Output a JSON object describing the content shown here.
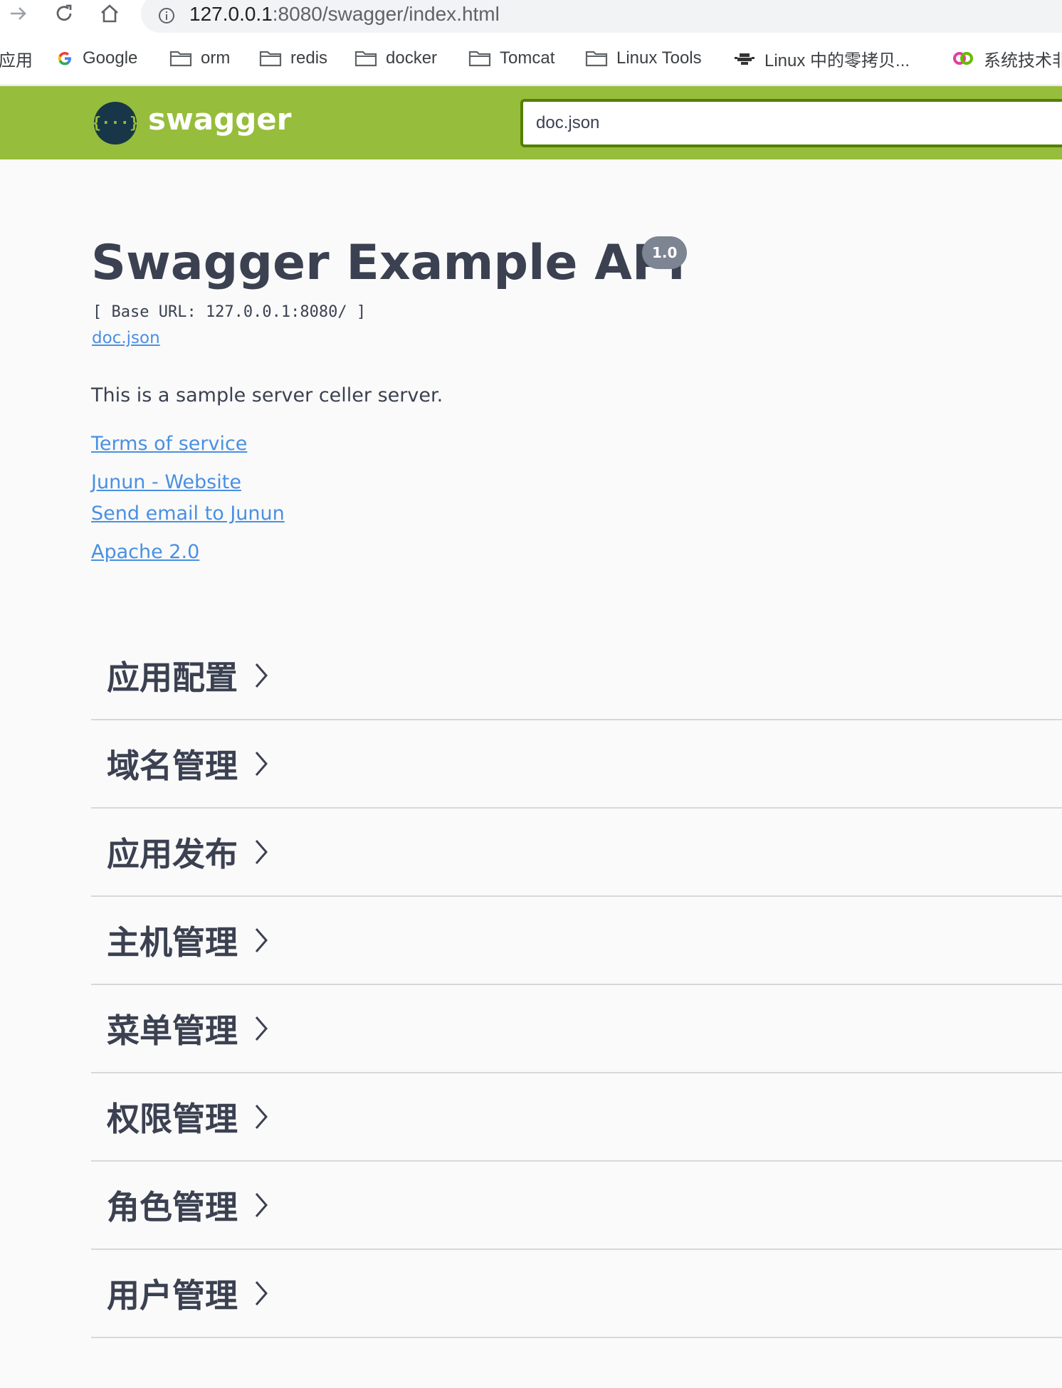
{
  "browser": {
    "url_host": "127.0.0.1",
    "url_rest": ":8080/swagger/index.html",
    "bookmarks": [
      {
        "label": "应用",
        "icon": "apps-icon"
      },
      {
        "label": "Google",
        "icon": "google-icon"
      },
      {
        "label": "orm",
        "icon": "folder-icon"
      },
      {
        "label": "redis",
        "icon": "folder-icon"
      },
      {
        "label": "docker",
        "icon": "folder-icon"
      },
      {
        "label": "Tomcat",
        "icon": "folder-icon"
      },
      {
        "label": "Linux Tools",
        "icon": "folder-icon"
      },
      {
        "label": "Linux 中的零拷贝...",
        "icon": "site-icon"
      },
      {
        "label": "系统技术非",
        "icon": "site-icon"
      }
    ]
  },
  "topbar": {
    "logo_text": "swagger",
    "logo_glyph": "{···}",
    "spec_url": "doc.json",
    "bar_color": "#96bd3b"
  },
  "info": {
    "title": "Swagger Example API",
    "version": "1.0",
    "base_url": "[ Base URL: 127.0.0.1:8080/ ]",
    "spec_link": "doc.json",
    "description": "This is a sample server celler server.",
    "terms_link": "Terms of service",
    "contact_website": "Junun - Website",
    "contact_email": "Send email to Junun",
    "license": "Apache 2.0"
  },
  "tags": [
    {
      "label": "应用配置"
    },
    {
      "label": "域名管理"
    },
    {
      "label": "应用发布"
    },
    {
      "label": "主机管理"
    },
    {
      "label": "菜单管理"
    },
    {
      "label": "权限管理"
    },
    {
      "label": "角色管理"
    },
    {
      "label": "用户管理"
    }
  ]
}
